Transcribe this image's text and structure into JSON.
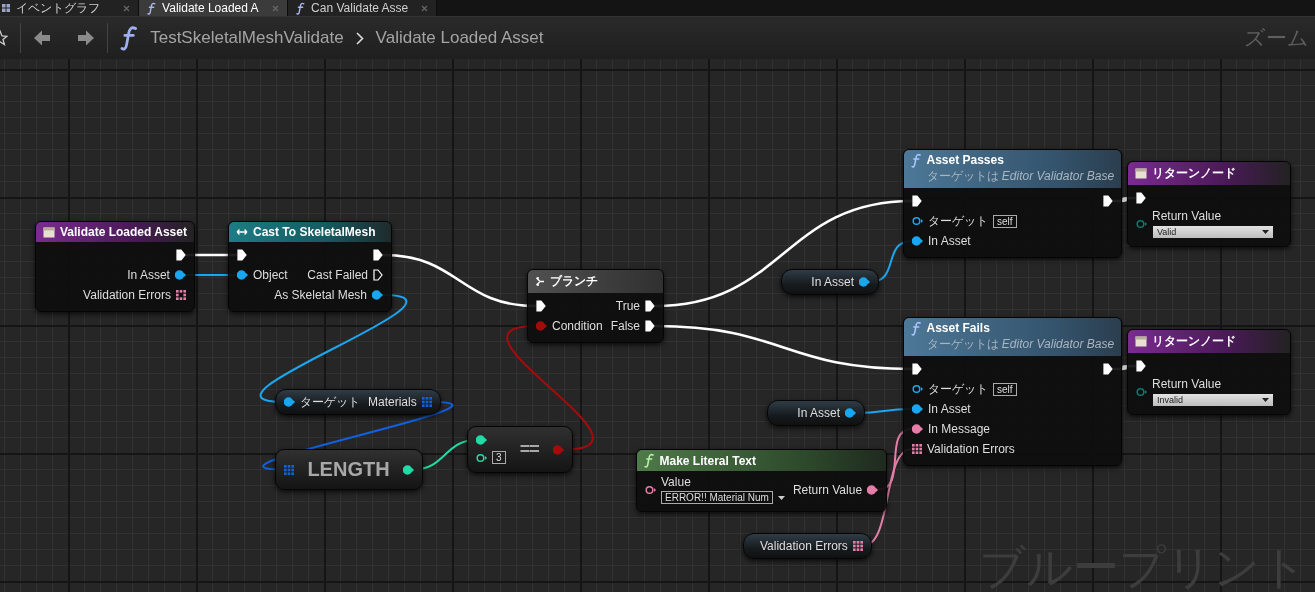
{
  "tabs": [
    {
      "kind": "graph",
      "label": "イベントグラフ",
      "selected": false
    },
    {
      "kind": "function",
      "label": "Validate Loaded A",
      "selected": true
    },
    {
      "kind": "function",
      "label": "Can Validate Asse",
      "selected": false
    }
  ],
  "toolbar": {
    "breadcrumb": [
      "TestSkeletalMeshValidate",
      "Validate Loaded Asset"
    ],
    "zoom_label": "ズーム"
  },
  "graph": {
    "graph_type_label": "ブループリント",
    "nodes": [
      {
        "kind": "entry",
        "title": "Validate Loaded Asset",
        "rows": [
          {
            "out": {
              "kind": "exec",
              "connected": true
            }
          },
          {
            "out": {
              "kind": "object",
              "label": "In Asset",
              "connected": true
            }
          },
          {
            "out": {
              "kind": "text_array",
              "label": "Validation Errors",
              "connected": false
            }
          }
        ]
      },
      {
        "kind": "cast",
        "title": "Cast To SkeletalMesh",
        "rows": [
          {
            "in": {
              "kind": "exec",
              "connected": true
            },
            "out": {
              "kind": "exec",
              "connected": true
            }
          },
          {
            "in": {
              "kind": "object",
              "label": "Object",
              "connected": true
            },
            "out": {
              "kind": "exec",
              "label": "Cast Failed",
              "connected": false
            }
          },
          {
            "out": {
              "kind": "object",
              "label": "As Skeletal Mesh",
              "connected": true
            }
          }
        ]
      },
      {
        "kind": "branch",
        "title": "ブランチ",
        "rows": [
          {
            "in": {
              "kind": "exec",
              "connected": true
            },
            "out": {
              "kind": "exec",
              "label": "True",
              "connected": true
            }
          },
          {
            "in": {
              "kind": "bool",
              "label": "Condition",
              "connected": true
            },
            "out": {
              "kind": "exec",
              "label": "False",
              "connected": true
            }
          }
        ]
      },
      {
        "kind": "variable",
        "rows": [
          {
            "in": {
              "kind": "object",
              "label": "ターゲット",
              "connected": true
            },
            "out": {
              "kind": "object_array",
              "label": "Materials",
              "connected": true
            }
          }
        ]
      },
      {
        "kind": "operator",
        "title": "LENGTH",
        "rows": [
          {
            "in": {
              "kind": "object_array",
              "connected": true
            },
            "out": {
              "kind": "int",
              "connected": true
            }
          }
        ]
      },
      {
        "kind": "operator",
        "title": "==",
        "rows": [
          {
            "in": {
              "kind": "int",
              "connected": true
            },
            "out": {
              "kind": "bool",
              "connected": true
            }
          },
          {
            "in": {
              "kind": "int",
              "value": "3",
              "connected": false
            }
          }
        ]
      },
      {
        "kind": "function",
        "title": "Asset Passes",
        "subtitle": "ターゲットは *Editor Validator Base*",
        "rows": [
          {
            "in": {
              "kind": "exec",
              "connected": true
            },
            "out": {
              "kind": "exec",
              "connected": true
            }
          },
          {
            "in": {
              "kind": "object",
              "label": "ターゲット",
              "value": "self",
              "connected": false
            }
          },
          {
            "in": {
              "kind": "object",
              "label": "In Asset",
              "connected": true
            }
          }
        ]
      },
      {
        "kind": "return",
        "title": "リターンノード",
        "rows": [
          {
            "in": {
              "kind": "exec",
              "connected": true
            }
          },
          {
            "in": {
              "kind": "enum",
              "label": "Return Value",
              "value": "Valid",
              "connected": false
            }
          }
        ]
      },
      {
        "kind": "variable",
        "rows": [
          {
            "out": {
              "kind": "object",
              "label": "In Asset",
              "connected": true
            }
          }
        ]
      },
      {
        "kind": "function",
        "title": "Asset Fails",
        "subtitle": "ターゲットは *Editor Validator Base*",
        "rows": [
          {
            "in": {
              "kind": "exec",
              "connected": true
            },
            "out": {
              "kind": "exec",
              "connected": true
            }
          },
          {
            "in": {
              "kind": "object",
              "label": "ターゲット",
              "value": "self",
              "connected": false
            }
          },
          {
            "in": {
              "kind": "object",
              "label": "In Asset",
              "connected": true
            }
          },
          {
            "in": {
              "kind": "text",
              "label": "In Message",
              "connected": true
            }
          },
          {
            "in": {
              "kind": "text_array",
              "label": "Validation Errors",
              "connected": true
            }
          }
        ]
      },
      {
        "kind": "return",
        "title": "リターンノード",
        "rows": [
          {
            "in": {
              "kind": "exec",
              "connected": true
            }
          },
          {
            "in": {
              "kind": "enum",
              "label": "Return Value",
              "value": "Invalid",
              "connected": false
            }
          }
        ]
      },
      {
        "kind": "variable",
        "rows": [
          {
            "out": {
              "kind": "object",
              "label": "In Asset",
              "connected": true
            }
          }
        ]
      },
      {
        "kind": "pure",
        "title": "Make Literal Text",
        "rows": [
          {
            "in": {
              "kind": "text",
              "label": "Value",
              "value": "ERROR!! Material Num",
              "connected": false
            },
            "out": {
              "kind": "text",
              "label": "Return Value",
              "connected": true
            }
          }
        ]
      },
      {
        "kind": "variable",
        "rows": [
          {
            "out": {
              "kind": "text_array",
              "label": "Validation Errors",
              "connected": true
            }
          }
        ]
      }
    ]
  }
}
